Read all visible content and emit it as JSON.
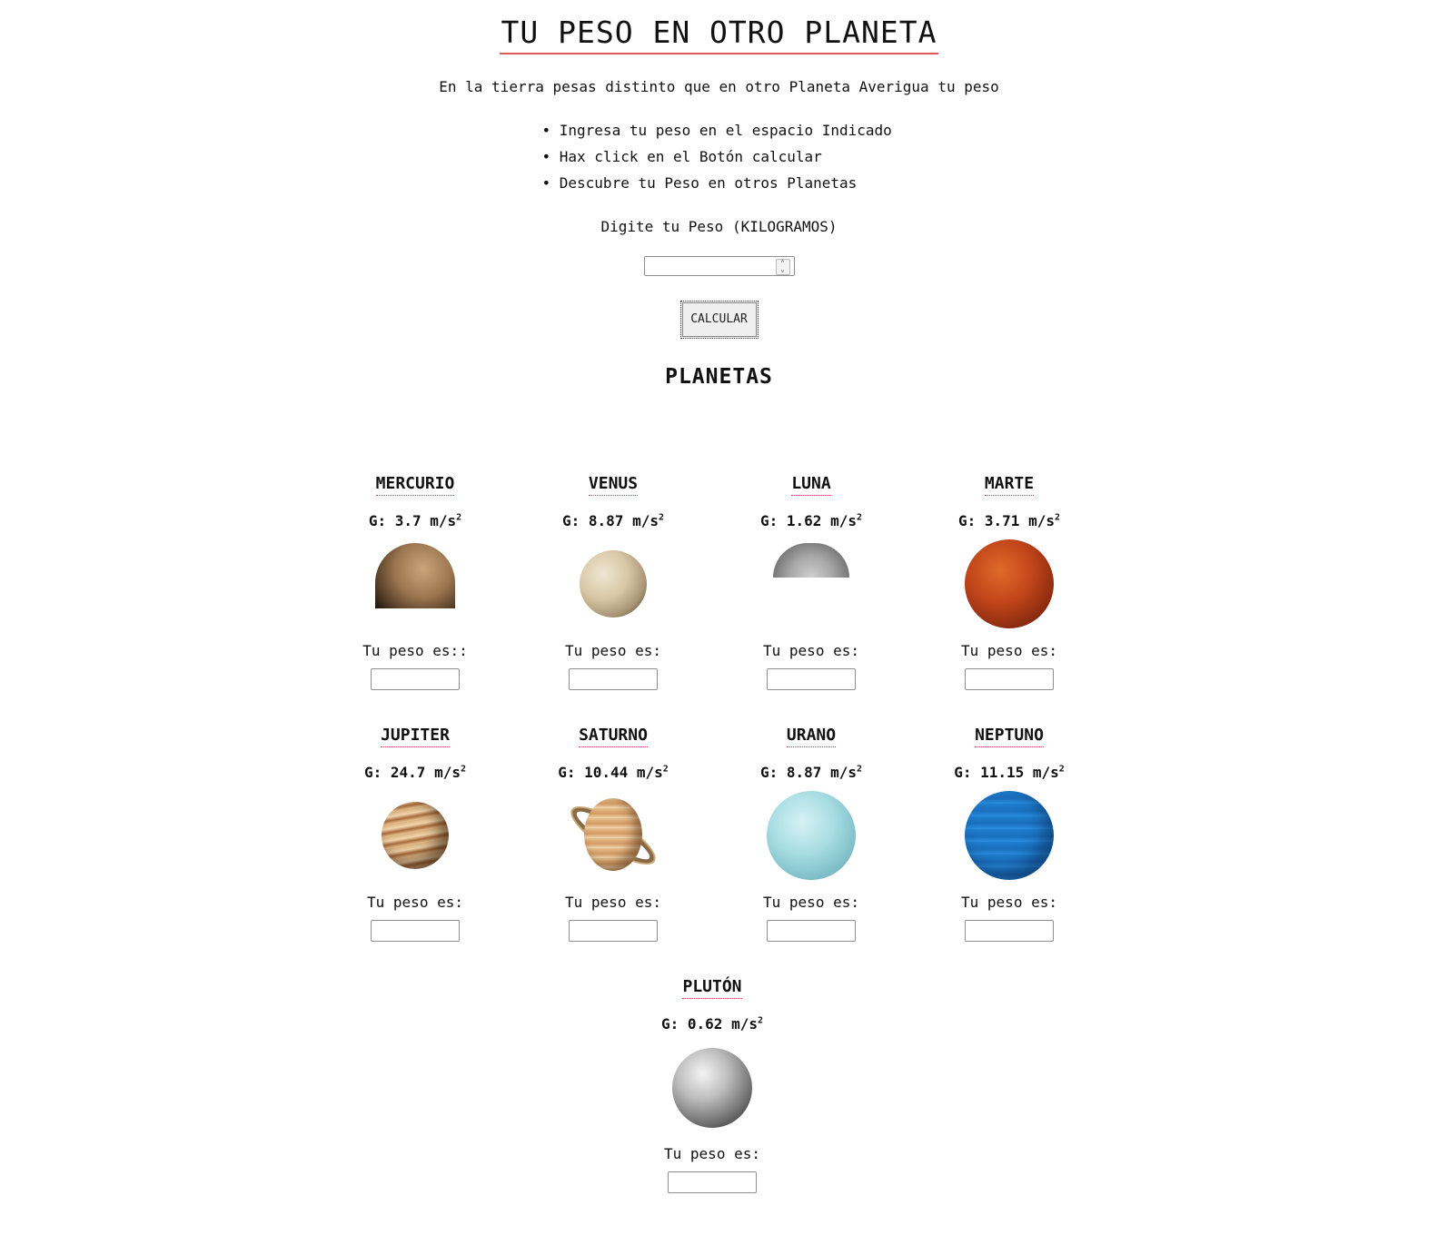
{
  "header": {
    "title": "TU PESO EN OTRO PLANETA",
    "subtitle": "En la tierra pesas distinto que en otro Planeta Averigua tu peso"
  },
  "steps": [
    "Ingresa tu peso en el espacio Indicado",
    "Hax click en el Botón calcular",
    "Descubre tu Peso en otros Planetas"
  ],
  "form": {
    "weight_label": "Digite tu Peso (KILOGRAMOS)",
    "weight_value": "",
    "calculate_label": "CALCULAR"
  },
  "planets_heading": "PLANETAS",
  "planets": [
    {
      "name": "MERCURIO",
      "gravity": "G: 3.7 m/s",
      "weight_label": "Tu peso es::",
      "weight_value": ""
    },
    {
      "name": "VENUS",
      "gravity": "G: 8.87 m/s",
      "weight_label": "Tu peso es:",
      "weight_value": ""
    },
    {
      "name": "LUNA",
      "gravity": "G: 1.62 m/s",
      "weight_label": "Tu peso es:",
      "weight_value": ""
    },
    {
      "name": "MARTE",
      "gravity": "G: 3.71 m/s",
      "weight_label": "Tu peso es:",
      "weight_value": ""
    },
    {
      "name": "JUPITER",
      "gravity": "G: 24.7 m/s",
      "weight_label": "Tu peso es:",
      "weight_value": ""
    },
    {
      "name": "SATURNO",
      "gravity": "G: 10.44 m/s",
      "weight_label": "Tu peso es:",
      "weight_value": ""
    },
    {
      "name": "URANO",
      "gravity": "G: 8.87 m/s",
      "weight_label": "Tu peso es:",
      "weight_value": ""
    },
    {
      "name": "NEPTUNO",
      "gravity": "G: 11.15 m/s",
      "weight_label": "Tu peso es:",
      "weight_value": ""
    },
    {
      "name": "PLUTÓN",
      "gravity": "G: 0.62 m/s",
      "weight_label": "Tu peso es:",
      "weight_value": ""
    }
  ],
  "gravity_exponent": "2",
  "colors": {
    "title_underline": "#e05a5a",
    "name_underline": "#dd3355"
  }
}
